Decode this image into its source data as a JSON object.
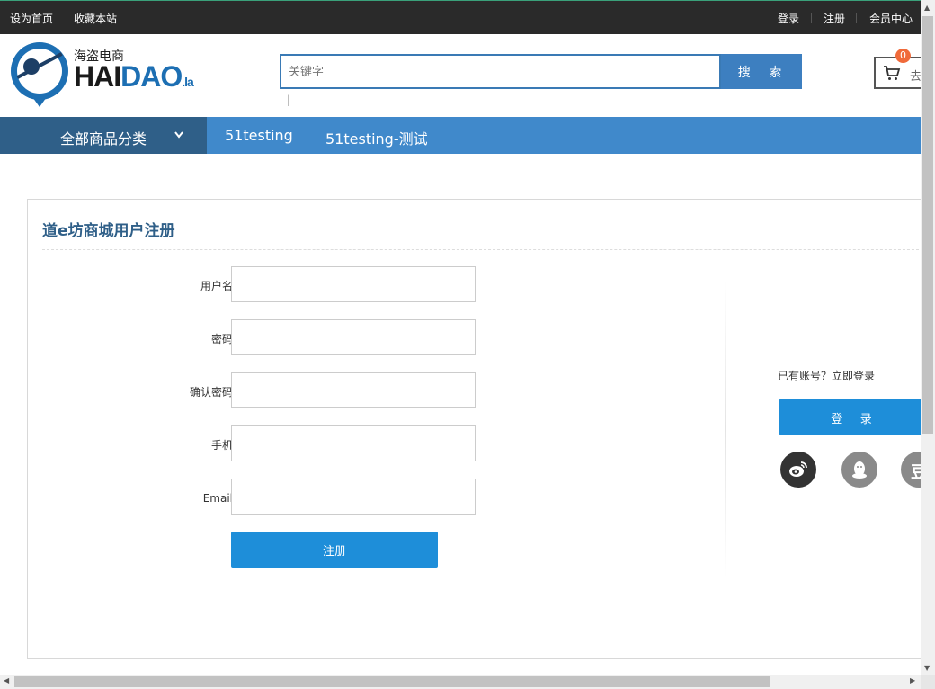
{
  "topbar": {
    "set_home": "设为首页",
    "bookmark": "收藏本站",
    "login": "登录",
    "register": "注册",
    "member_center": "会员中心"
  },
  "logo": {
    "cn": "海盗电商",
    "en_main": "HAI",
    "en_accent": "DAO",
    "en_suffix": ".la"
  },
  "search": {
    "placeholder": "关键字",
    "button": "搜 索",
    "hotwords": "|"
  },
  "cart": {
    "count": "0",
    "label": "去"
  },
  "nav": {
    "category_label": "全部商品分类",
    "category_chevron": "⌄",
    "links": [
      "51testing",
      "51testing-测试"
    ]
  },
  "register_panel": {
    "title": "道e坊商城用户注册",
    "fields": [
      {
        "label": "用户名：",
        "value": ""
      },
      {
        "label": "密码：",
        "value": ""
      },
      {
        "label": "确认密码：",
        "value": ""
      },
      {
        "label": "手机：",
        "value": ""
      },
      {
        "label": "Email：",
        "value": ""
      }
    ],
    "submit": "注册"
  },
  "side": {
    "have_account": "已有账号？立即登录",
    "login_button": "登 录",
    "socials": [
      "weibo-icon",
      "qq-icon",
      "douban-icon"
    ],
    "douban_glyph": "豆"
  },
  "colors": {
    "primary": "#1e8ed9",
    "nav": "#4089cb",
    "nav_dark": "#2f5f88",
    "topbar": "#2a2a2a"
  }
}
